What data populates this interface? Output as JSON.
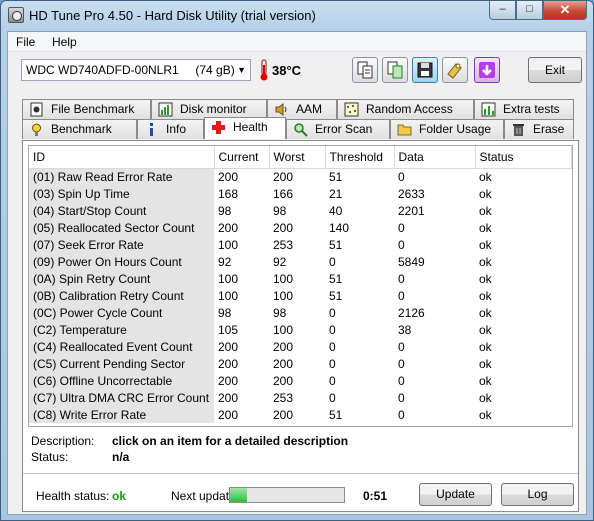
{
  "window": {
    "title": "HD Tune Pro 4.50 - Hard Disk Utility (trial version)"
  },
  "caption": {
    "minimize": "–",
    "maximize": "□",
    "close": "✕"
  },
  "menu": {
    "items": [
      "File",
      "Help"
    ]
  },
  "toolbar": {
    "drive": "WDC WD740ADFD-00NLR1     (74 gB)",
    "temperature": "38°C",
    "exit_label": "Exit",
    "buttons": [
      "copy-info-icon",
      "copy-screenshot-icon",
      "save-icon",
      "options-icon",
      "download-icon"
    ]
  },
  "tabs": {
    "row_top": [
      {
        "label": "File Benchmark",
        "icon": "file-benchmark-icon"
      },
      {
        "label": "Disk monitor",
        "icon": "disk-monitor-icon"
      },
      {
        "label": "AAM",
        "icon": "speaker-icon"
      },
      {
        "label": "Random Access",
        "icon": "random-access-icon"
      },
      {
        "label": "Extra tests",
        "icon": "extra-tests-icon"
      }
    ],
    "row_bottom": [
      {
        "label": "Benchmark",
        "icon": "benchmark-icon"
      },
      {
        "label": "Info",
        "icon": "info-icon"
      },
      {
        "label": "Health",
        "icon": "health-cross-icon",
        "active": true
      },
      {
        "label": "Error Scan",
        "icon": "magnifier-icon"
      },
      {
        "label": "Folder Usage",
        "icon": "folder-icon"
      },
      {
        "label": "Erase",
        "icon": "trash-icon"
      }
    ]
  },
  "health": {
    "columns": [
      "ID",
      "Current",
      "Worst",
      "Threshold",
      "Data",
      "Status"
    ],
    "rows": [
      [
        "(01) Raw Read Error Rate",
        "200",
        "200",
        "51",
        "0",
        "ok"
      ],
      [
        "(03) Spin Up Time",
        "168",
        "166",
        "21",
        "2633",
        "ok"
      ],
      [
        "(04) Start/Stop Count",
        "98",
        "98",
        "40",
        "2201",
        "ok"
      ],
      [
        "(05) Reallocated Sector Count",
        "200",
        "200",
        "140",
        "0",
        "ok"
      ],
      [
        "(07) Seek Error Rate",
        "100",
        "253",
        "51",
        "0",
        "ok"
      ],
      [
        "(09) Power On Hours Count",
        "92",
        "92",
        "0",
        "5849",
        "ok"
      ],
      [
        "(0A) Spin Retry Count",
        "100",
        "100",
        "51",
        "0",
        "ok"
      ],
      [
        "(0B) Calibration Retry Count",
        "100",
        "100",
        "51",
        "0",
        "ok"
      ],
      [
        "(0C) Power Cycle Count",
        "98",
        "98",
        "0",
        "2126",
        "ok"
      ],
      [
        "(C2) Temperature",
        "105",
        "100",
        "0",
        "38",
        "ok"
      ],
      [
        "(C4) Reallocated Event Count",
        "200",
        "200",
        "0",
        "0",
        "ok"
      ],
      [
        "(C5) Current Pending Sector",
        "200",
        "200",
        "0",
        "0",
        "ok"
      ],
      [
        "(C6) Offline Uncorrectable",
        "200",
        "200",
        "0",
        "0",
        "ok"
      ],
      [
        "(C7) Ultra DMA CRC Error Count",
        "200",
        "253",
        "0",
        "0",
        "ok"
      ],
      [
        "(C8) Write Error Rate",
        "200",
        "200",
        "51",
        "0",
        "ok"
      ]
    ],
    "description_label": "Description:",
    "description_value": "click on an item for a detailed description",
    "status_label": "Status:",
    "status_value": "n/a"
  },
  "footer": {
    "health_status_label": "Health status:",
    "health_status_value": "ok",
    "health_status_color": "#1a9a1a",
    "next_update_label": "Next update:",
    "next_update_progress": 0.15,
    "next_update_time": "0:51",
    "update_label": "Update",
    "log_label": "Log"
  }
}
